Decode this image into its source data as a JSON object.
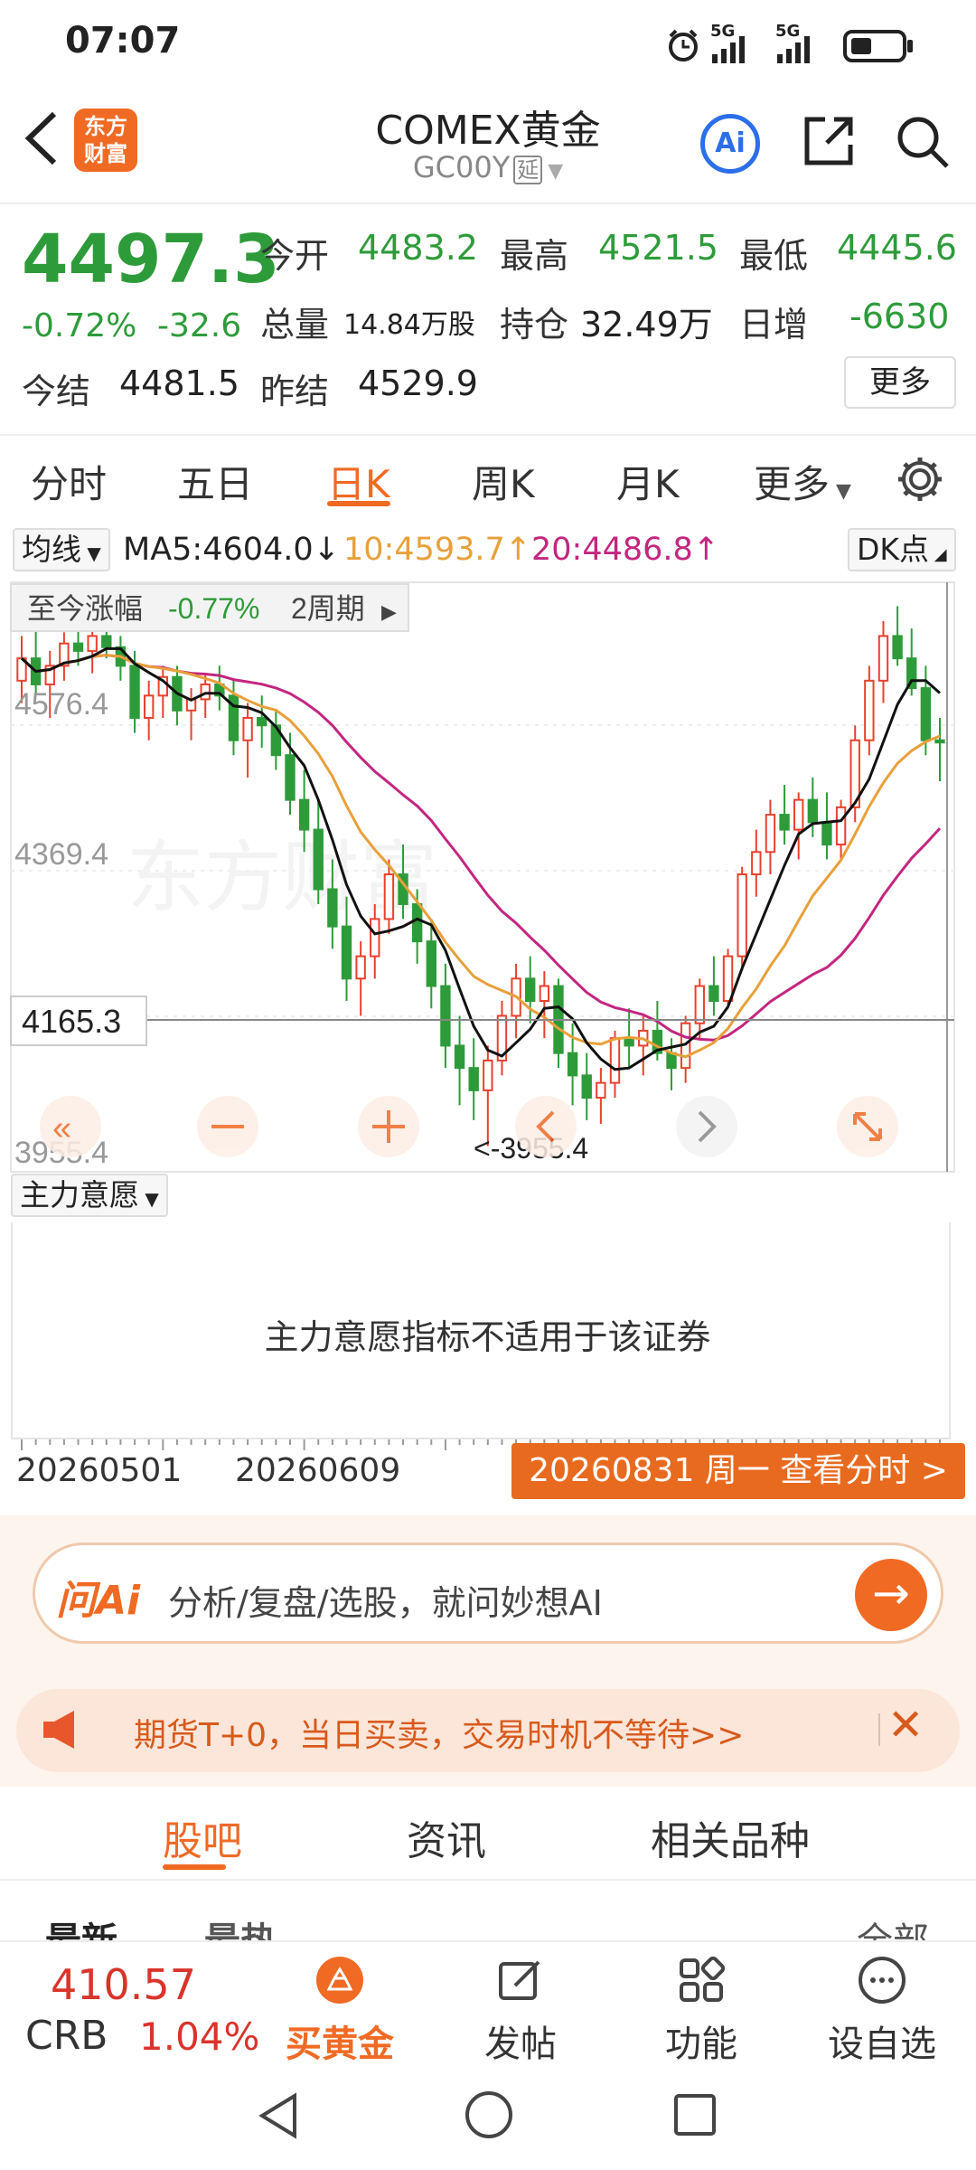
{
  "status": {
    "time": "07:07",
    "net1": "5G",
    "net2": "5G"
  },
  "header": {
    "logo_line1": "东方",
    "logo_line2": "财富",
    "title": "COMEX黄金",
    "code": "GC00Y",
    "delay_badge": "延",
    "ai_label": "Ai"
  },
  "quote": {
    "price": "4497.3",
    "pct": "-0.72%",
    "change": "-32.6",
    "open_label": "今开",
    "open": "4483.2",
    "high_label": "最高",
    "high": "4521.5",
    "low_label": "最低",
    "low": "4445.6",
    "volume_label": "总量",
    "volume": "14.84万股",
    "oi_label": "持仓",
    "oi": "32.49万",
    "inc_label": "日增",
    "inc": "-6630",
    "settle_label": "今结",
    "settle": "4481.5",
    "prev_label": "昨结",
    "prev": "4529.9",
    "more": "更多"
  },
  "tabs": [
    "分时",
    "五日",
    "日K",
    "周K",
    "月K",
    "更多"
  ],
  "ma": {
    "type": "均线",
    "ma5": "MA5:4604.0",
    "ma5_arrow": "↓",
    "ma10": "10:4593.7",
    "ma10_arrow": "↑",
    "ma20": "20:4486.8",
    "ma20_arrow": "↑",
    "dk": "DK点"
  },
  "range": {
    "label": "至今涨幅",
    "value": "-0.77%",
    "period": "2周期"
  },
  "chart_data": {
    "type": "candlestick",
    "y_ticks": [
      "4576.4",
      "4369.4",
      "3955.4"
    ],
    "crosshair_price": "4165.3",
    "min_marker": "<-3955.4",
    "colors": {
      "up": "#e8412e",
      "down": "#2e9b3a",
      "ma5": "#111111",
      "ma10": "#e8a03a",
      "ma20": "#c3267f"
    },
    "ohlc": [
      [
        4580,
        4640,
        4550,
        4610
      ],
      [
        4610,
        4650,
        4560,
        4575
      ],
      [
        4575,
        4620,
        4530,
        4600
      ],
      [
        4600,
        4645,
        4580,
        4630
      ],
      [
        4630,
        4660,
        4600,
        4620
      ],
      [
        4620,
        4650,
        4590,
        4640
      ],
      [
        4640,
        4660,
        4610,
        4625
      ],
      [
        4625,
        4640,
        4580,
        4600
      ],
      [
        4600,
        4620,
        4510,
        4530
      ],
      [
        4530,
        4580,
        4500,
        4560
      ],
      [
        4560,
        4600,
        4530,
        4585
      ],
      [
        4585,
        4600,
        4520,
        4540
      ],
      [
        4540,
        4570,
        4500,
        4555
      ],
      [
        4555,
        4590,
        4530,
        4575
      ],
      [
        4575,
        4600,
        4540,
        4560
      ],
      [
        4560,
        4580,
        4480,
        4500
      ],
      [
        4500,
        4550,
        4450,
        4530
      ],
      [
        4530,
        4560,
        4490,
        4520
      ],
      [
        4520,
        4540,
        4460,
        4480
      ],
      [
        4480,
        4510,
        4400,
        4420
      ],
      [
        4420,
        4460,
        4350,
        4380
      ],
      [
        4380,
        4420,
        4280,
        4300
      ],
      [
        4300,
        4340,
        4220,
        4250
      ],
      [
        4250,
        4290,
        4150,
        4180
      ],
      [
        4180,
        4230,
        4130,
        4210
      ],
      [
        4210,
        4280,
        4180,
        4260
      ],
      [
        4260,
        4340,
        4240,
        4320
      ],
      [
        4320,
        4360,
        4260,
        4280
      ],
      [
        4280,
        4300,
        4200,
        4230
      ],
      [
        4230,
        4260,
        4140,
        4170
      ],
      [
        4170,
        4200,
        4060,
        4090
      ],
      [
        4090,
        4130,
        4010,
        4060
      ],
      [
        4060,
        4100,
        3990,
        4030
      ],
      [
        4030,
        4090,
        3955,
        4070
      ],
      [
        4070,
        4150,
        4050,
        4130
      ],
      [
        4130,
        4200,
        4100,
        4180
      ],
      [
        4180,
        4210,
        4120,
        4150
      ],
      [
        4150,
        4190,
        4100,
        4170
      ],
      [
        4170,
        4180,
        4060,
        4080
      ],
      [
        4080,
        4120,
        4010,
        4050
      ],
      [
        4050,
        4080,
        3990,
        4020
      ],
      [
        4020,
        4060,
        3985,
        4040
      ],
      [
        4040,
        4110,
        4020,
        4100
      ],
      [
        4100,
        4140,
        4060,
        4090
      ],
      [
        4090,
        4130,
        4050,
        4110
      ],
      [
        4110,
        4150,
        4070,
        4080
      ],
      [
        4080,
        4100,
        4030,
        4060
      ],
      [
        4060,
        4130,
        4040,
        4120
      ],
      [
        4120,
        4180,
        4100,
        4170
      ],
      [
        4170,
        4210,
        4130,
        4150
      ],
      [
        4150,
        4220,
        4140,
        4210
      ],
      [
        4210,
        4330,
        4190,
        4320
      ],
      [
        4320,
        4380,
        4290,
        4350
      ],
      [
        4350,
        4420,
        4320,
        4400
      ],
      [
        4400,
        4440,
        4360,
        4380
      ],
      [
        4380,
        4430,
        4340,
        4420
      ],
      [
        4420,
        4450,
        4370,
        4390
      ],
      [
        4390,
        4430,
        4340,
        4360
      ],
      [
        4360,
        4420,
        4340,
        4410
      ],
      [
        4410,
        4520,
        4390,
        4500
      ],
      [
        4500,
        4600,
        4480,
        4580
      ],
      [
        4580,
        4660,
        4550,
        4640
      ],
      [
        4640,
        4680,
        4600,
        4610
      ],
      [
        4610,
        4650,
        4560,
        4570
      ],
      [
        4570,
        4600,
        4480,
        4500
      ],
      [
        4500,
        4530,
        4445,
        4497
      ]
    ],
    "x_tick_labels": [
      "20260501",
      "20260609"
    ]
  },
  "indicator": {
    "name": "主力意愿",
    "message": "主力意愿指标不适用于该证券"
  },
  "dates": {
    "d1": "20260501",
    "d2": "20260609",
    "badge": "20260831 周一 查看分时 >"
  },
  "ai": {
    "logo": "问Ai",
    "text": "分析/复盘/选股，就问妙想AI"
  },
  "promo": {
    "text": "期货T+0，当日买卖，交易时机不等待>>"
  },
  "btabs": [
    "股吧",
    "资讯",
    "相关品种"
  ],
  "feed": {
    "t1": "最新",
    "t2": "最热",
    "t3": "全部"
  },
  "bottom": {
    "crb_value": "410.57",
    "crb_name": "CRB",
    "crb_pct": "1.04%",
    "buy_gold": "买黄金",
    "post": "发帖",
    "func": "功能",
    "set_fav": "设自选"
  }
}
